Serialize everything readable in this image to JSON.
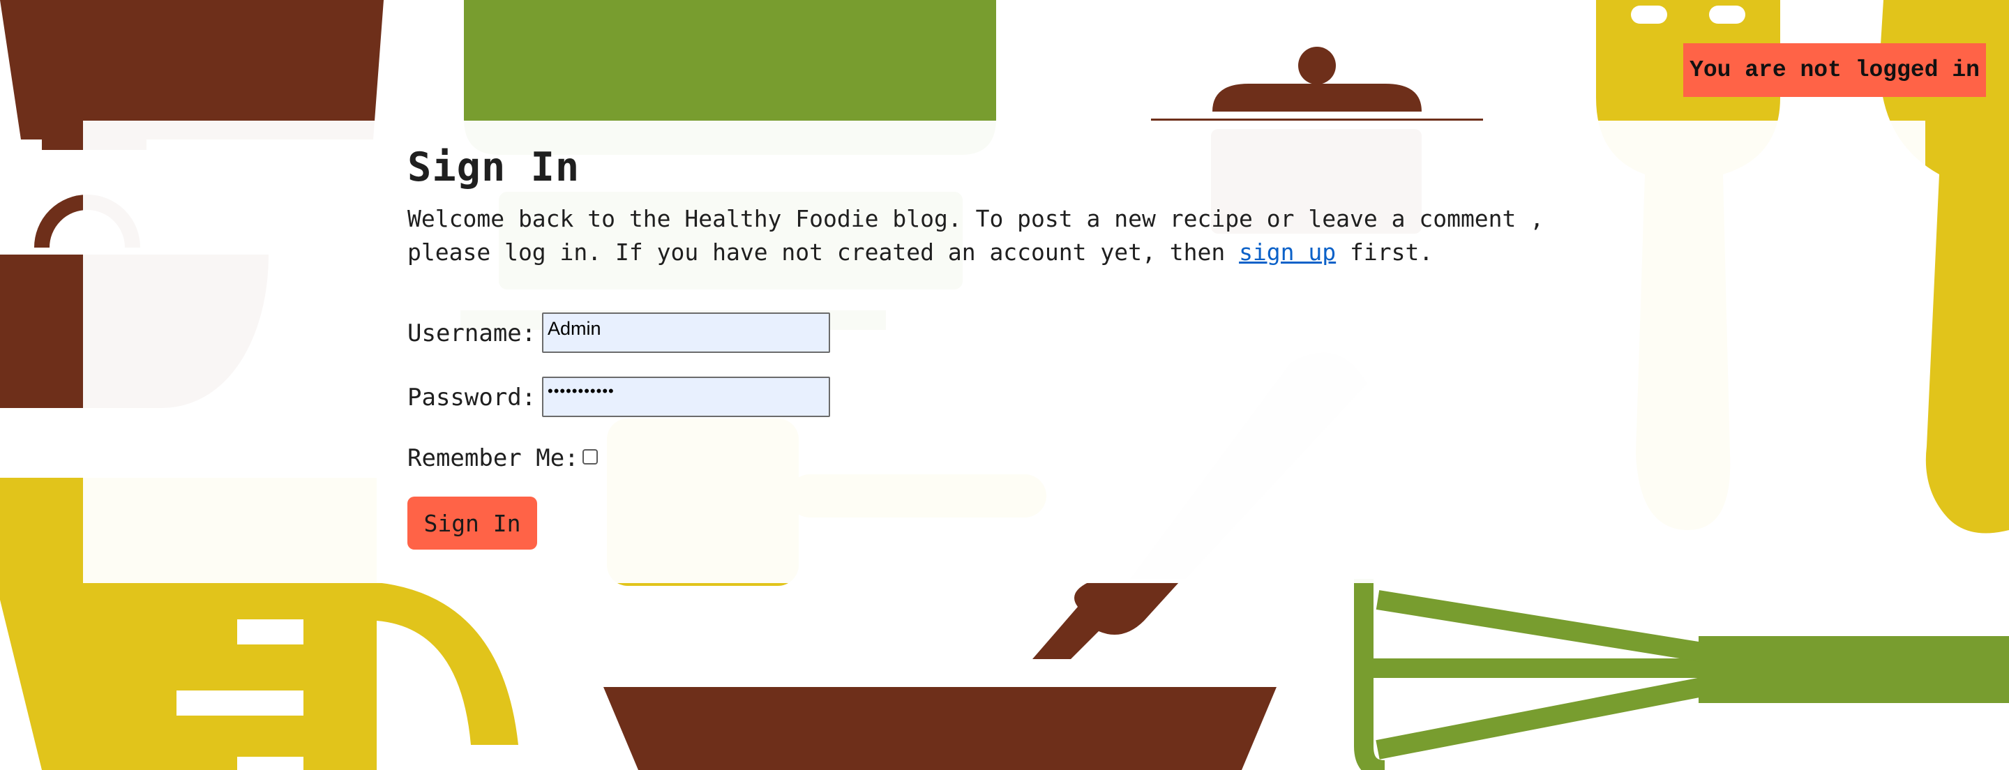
{
  "status": {
    "text": "You are not logged in"
  },
  "page": {
    "title": "Sign In",
    "intro_before": "Welcome back to the Healthy Foodie blog. To post a new recipe or leave a comment , please log in. If you have not created an account yet, then ",
    "intro_link": "sign up",
    "intro_after": " first."
  },
  "form": {
    "username_label": "Username:",
    "username_value": "Admin",
    "password_label": "Password:",
    "password_masked": "•••••••••••",
    "remember_label": "Remember Me:",
    "remember_checked": false,
    "submit_label": "Sign In"
  },
  "colors": {
    "brown": "#6e2f1a",
    "green": "#789d2f",
    "yellow": "#e1c41b",
    "accent": "#ff6347",
    "input_bg": "#e8f0fe",
    "link": "#0b61c8"
  },
  "background_icons": [
    "coffee-grinder-icon",
    "saucepan-icon",
    "cooking-pot-icon",
    "spatula-icon",
    "measuring-cup-icon",
    "grater-icon",
    "rolling-pin-icon",
    "skillet-icon",
    "whisk-icon",
    "wooden-spoon-icon"
  ]
}
